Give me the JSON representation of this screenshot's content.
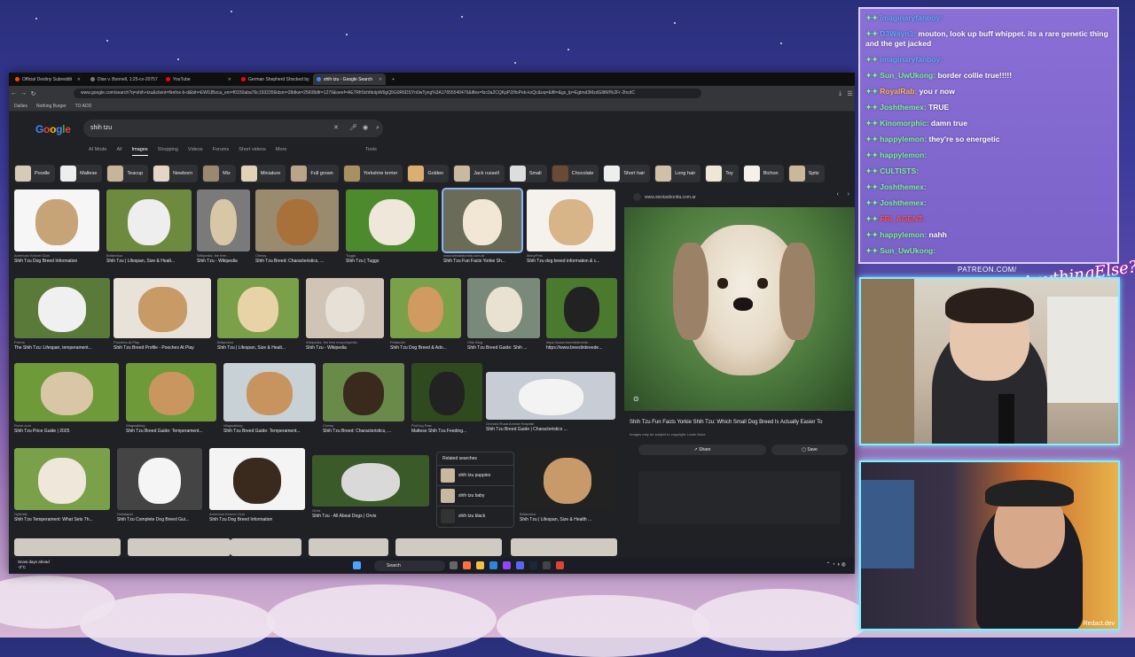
{
  "browser": {
    "tabs": [
      {
        "label": "Official Destiny Subreddit",
        "active": false
      },
      {
        "label": "Dise v. Bonnell, 1:25-cv-20757",
        "active": false
      },
      {
        "label": "YouTube",
        "active": false
      },
      {
        "label": "German Shepherd Shocked by",
        "active": false
      },
      {
        "label": "shih tzu - Google Search",
        "active": true
      }
    ],
    "url": "www.google.com/search?q=shih+tzu&client=firefox-b-d&bih=EW0JBzca_em=f0150aba76c1932356idsm=28dkw=25608dfr=1279&oeef=AE7Rfr9chfdolpW6gQ5G0R6DSYn0wTyng%3A17655540476&iflex=fzc0a2CQKpPZifloPeb-kxQc&oq=&iflt=&gs_lp=Egtmd3MzdGltlWl%2Fr-2hcdC",
    "bookmarks": [
      "Dailies",
      "Nothing Burger",
      "TO ADD"
    ]
  },
  "google": {
    "logo": "Google",
    "query": "shih tzu",
    "modes": [
      "AI Mode",
      "All",
      "Images",
      "Shopping",
      "Videos",
      "Forums",
      "Short videos",
      "More"
    ],
    "active_mode": "Images",
    "tools": "Tools",
    "chips": [
      "Poodle",
      "Maltese",
      "Teacup",
      "Newborn",
      "Mix",
      "Miniature",
      "Full grown",
      "Yorkshire terrier",
      "Golden",
      "Jack russell",
      "Small",
      "Chocolate",
      "Short hair",
      "Long hair",
      "Toy",
      "Bichon",
      "Spitz"
    ]
  },
  "results": [
    {
      "src": "American Kennel Club",
      "cap": "Shih Tzu Dog Breed Information"
    },
    {
      "src": "Britannica",
      "cap": "Shih Tzu | Lifespan, Size & Healt..."
    },
    {
      "src": "Wikipedia, the free ...",
      "cap": "Shih Tzu - Wikipedia"
    },
    {
      "src": "Chewy",
      "cap": "Shih Tzu Breed: Characteristics, ..."
    },
    {
      "src": "Tuggs",
      "cap": "Shih Tzu | Tuggs"
    },
    {
      "src": "www.siestasbonita.com.ar",
      "cap": "Shih Tzu Fun Facts Yorkie Sh..."
    },
    {
      "src": "ManyPets",
      "cap": "Shih Tzu dog breed information & c..."
    },
    {
      "src": "Prema",
      "cap": "The Shih Tzu: Lifespan, temperament..."
    },
    {
      "src": "Pooches At Play",
      "cap": "Shih Tzu Breed Profile - Pooches At Play"
    },
    {
      "src": "Britannica",
      "cap": "Shih Tzu | Lifespan, Size & Healt..."
    },
    {
      "src": "Wikipedia, the free encyclopedia",
      "cap": "Shih Tzu - Wikipedia"
    },
    {
      "src": "Petlander",
      "cap": "Shih Tzu Dog Breed & Ado..."
    },
    {
      "src": "Ollie Blog",
      "cap": "Shih Tzu Breed Guide: Shih ..."
    },
    {
      "src": "https://www.breedinbreede...",
      "cap": "https://www.breedinbreede..."
    },
    {
      "src": "Rover.com",
      "cap": "Shih Tzu Price Guide | 2025"
    },
    {
      "src": "Wagwalking",
      "cap": "Shih Tzu Breed Guide: Temperament..."
    },
    {
      "src": "Wagwalking",
      "cap": "Shih Tzu Breed Guide: Temperament..."
    },
    {
      "src": "Chewy",
      "cap": "Shih Tzu Breed: Characteristics, ..."
    },
    {
      "src": "ProDog Raw",
      "cap": "Maltese Shih Tzu Feeding..."
    },
    {
      "src": "Orchard Road Animal Hospital",
      "cap": "Shih Tzu Breed Guide | Characteristics ..."
    },
    {
      "src": "Optimist",
      "cap": "Shih Tzu Temperament: What Sets Th..."
    },
    {
      "src": "Holistapet",
      "cap": "Shih Tzu Complete Dog Breed Gui..."
    },
    {
      "src": "American Kennel Club",
      "cap": "Shih Tzu Dog Breed Information"
    },
    {
      "src": "Orvis",
      "cap": "Shih Tzu - All About Dogs | Orvis"
    },
    {
      "src": "Britannica",
      "cap": "Shih Tzu | Lifespan, Size & Health ..."
    }
  ],
  "related": {
    "title": "Related searches",
    "items": [
      "shih tzu puppies",
      "shih tzu baby",
      "shih tzu black"
    ]
  },
  "preview": {
    "site": "www.siestasbonita.com.ar",
    "title": "Shih Tzu Fun Facts Yorkie Shih Tzu: Which Small Dog Breed Is Actually Easier To",
    "subtitle": "Images may be subject to copyright. Learn More",
    "share": "Share",
    "save": "Save"
  },
  "taskbar": {
    "weather_line1": "Snow days ahead",
    "weather_line2": "-3°C",
    "search": "Search"
  },
  "chat": [
    {
      "user": "imaginaryfanboy:",
      "text": "",
      "color": "#5aa9ff"
    },
    {
      "user": "D3Wayn3:",
      "text": "mouton, look up buff whippet. its a rare genetic thing and the get jacked",
      "color": "#5aa9ff"
    },
    {
      "user": "imaginaryfanboy:",
      "text": "",
      "color": "#5aa9ff"
    },
    {
      "user": "Sun_UwUkong:",
      "text": "border collie true!!!!!",
      "color": "#7cf29a"
    },
    {
      "user": "RoyalRab:",
      "text": "you r now",
      "color": "#ffb347"
    },
    {
      "user": "Joshthemex:",
      "text": "TRUE",
      "color": "#7cf29a"
    },
    {
      "user": "Kinomorphic:",
      "text": "damn true",
      "color": "#7cf29a"
    },
    {
      "user": "happylemon:",
      "text": "they're so energetic",
      "color": "#7cf29a"
    },
    {
      "user": "happylemon:",
      "text": "",
      "color": "#7cf29a"
    },
    {
      "user": "CULTISTS:",
      "text": "",
      "color": "#7cf29a"
    },
    {
      "user": "Joshthemex:",
      "text": "",
      "color": "#7cf29a"
    },
    {
      "user": "Joshthemex:",
      "text": "",
      "color": "#7cf29a"
    },
    {
      "user": "FBI_AGENT:",
      "text": "",
      "color": "#ff4d4d"
    },
    {
      "user": "happylemon:",
      "text": "nahh",
      "color": "#7cf29a"
    },
    {
      "user": "Sun_UwUkong:",
      "text": "",
      "color": "#7cf29a"
    }
  ],
  "overlay": {
    "patreon": "PATREON.COM/",
    "script_logo": "AnythingElse?",
    "watermark": "Redact.dev"
  }
}
